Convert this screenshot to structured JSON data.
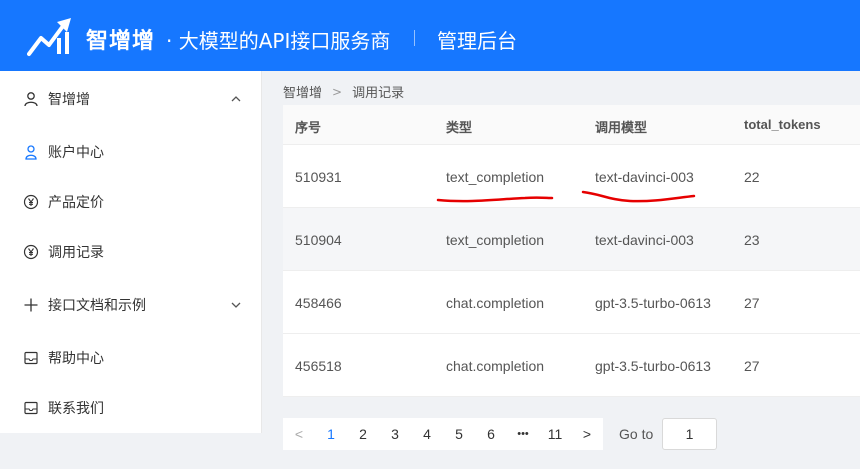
{
  "header": {
    "brand": "智增增",
    "tagline": "· 大模型的API接口服务商",
    "admin_title": "管理后台"
  },
  "sidebar": {
    "items": [
      {
        "label": "智增增",
        "icon": "user-icon",
        "expand": "chevron-up-icon"
      },
      {
        "label": "账户中心",
        "icon": "user-outline-icon"
      },
      {
        "label": "产品定价",
        "icon": "yen-circle-icon"
      },
      {
        "label": "调用记录",
        "icon": "yen-circle-icon"
      },
      {
        "label": "接口文档和示例",
        "icon": "plus-icon",
        "expand": "chevron-down-icon"
      },
      {
        "label": "帮助中心",
        "icon": "help-mail-icon"
      },
      {
        "label": "联系我们",
        "icon": "contact-mail-icon"
      }
    ]
  },
  "breadcrumb": {
    "root": "智增增",
    "separator": ">",
    "current": "调用记录"
  },
  "table": {
    "headers": [
      "序号",
      "类型",
      "调用模型",
      "total_tokens"
    ],
    "rows": [
      [
        "510931",
        "text_completion",
        "text-davinci-003",
        "22"
      ],
      [
        "510904",
        "text_completion",
        "text-davinci-003",
        "23"
      ],
      [
        "458466",
        "chat.completion",
        "gpt-3.5-turbo-0613",
        "27"
      ],
      [
        "456518",
        "chat.completion",
        "gpt-3.5-turbo-0613",
        "27"
      ]
    ]
  },
  "pagination": {
    "prev": "<",
    "pages": [
      "1",
      "2",
      "3",
      "4",
      "5",
      "6",
      "•••",
      "11"
    ],
    "next": ">",
    "current": "1",
    "goto_label": "Go to",
    "goto_value": "1"
  },
  "colors": {
    "header_bg": "#1677ff",
    "active": "#1677ff",
    "annotation": "#e60000"
  }
}
